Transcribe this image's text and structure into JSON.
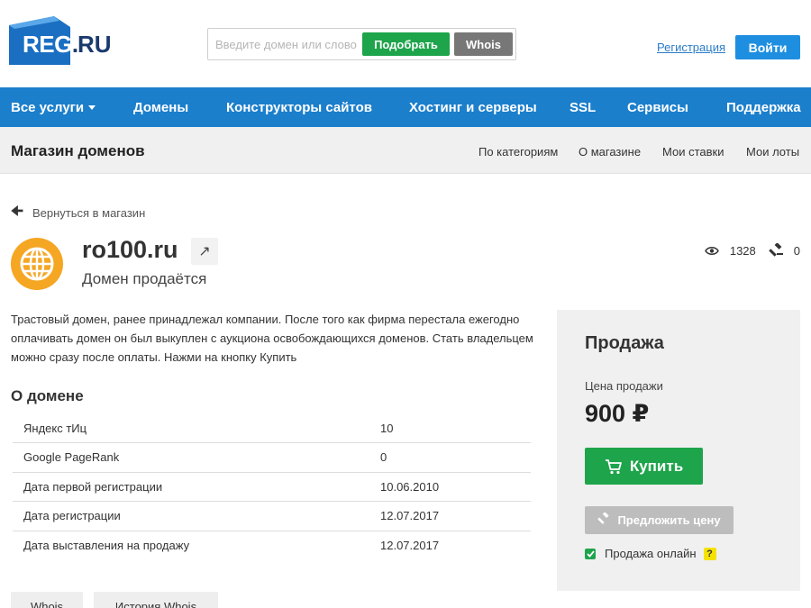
{
  "header": {
    "logo_main": "REG",
    "logo_dot": ".",
    "logo_suffix": "RU",
    "search_placeholder": "Введите домен или слово",
    "pick_label": "Подобрать",
    "whois_label": "Whois",
    "register_label": "Регистрация",
    "login_label": "Войти"
  },
  "nav": {
    "all_services": "Все услуги",
    "items": [
      "Домены",
      "Конструкторы сайтов",
      "Хостинг и серверы",
      "SSL",
      "Сервисы",
      "Поддержка"
    ]
  },
  "subnav": {
    "title": "Магазин доменов",
    "links": [
      "По категориям",
      "О магазине",
      "Мои ставки",
      "Мои лоты"
    ]
  },
  "back_label": "Вернуться в магазин",
  "domain": {
    "name": "ro100.ru",
    "status": "Домен продаётся",
    "views": "1328",
    "bids": "0",
    "description": "Трастовый домен, ранее принадлежал компании. После того как фирма перестала ежегодно оплачивать домен он был выкуплен с аукциона освобождающихся доменов. Стать владельцем можно сразу после оплаты. Нажми на кнопку Купить"
  },
  "about": {
    "title": "О домене",
    "rows": [
      {
        "label": "Яндекс тИц",
        "value": "10"
      },
      {
        "label": "Google PageRank",
        "value": "0"
      },
      {
        "label": "Дата первой регистрации",
        "value": "10.06.2010"
      },
      {
        "label": "Дата регистрации",
        "value": "12.07.2017"
      },
      {
        "label": "Дата выставления на продажу",
        "value": "12.07.2017"
      }
    ]
  },
  "bottom_buttons": [
    "Whois",
    "История Whois"
  ],
  "sale": {
    "title": "Продажа",
    "price_label": "Цена продажи",
    "price": "900 ₽",
    "buy_label": "Купить",
    "offer_label": "Предложить цену",
    "online_label": "Продажа онлайн",
    "help_mark": "?"
  },
  "colors": {
    "brand_blue": "#1b7fcc",
    "buy_green": "#1ea44b",
    "login_blue": "#1e8fe0",
    "globe_orange": "#f5a623"
  }
}
